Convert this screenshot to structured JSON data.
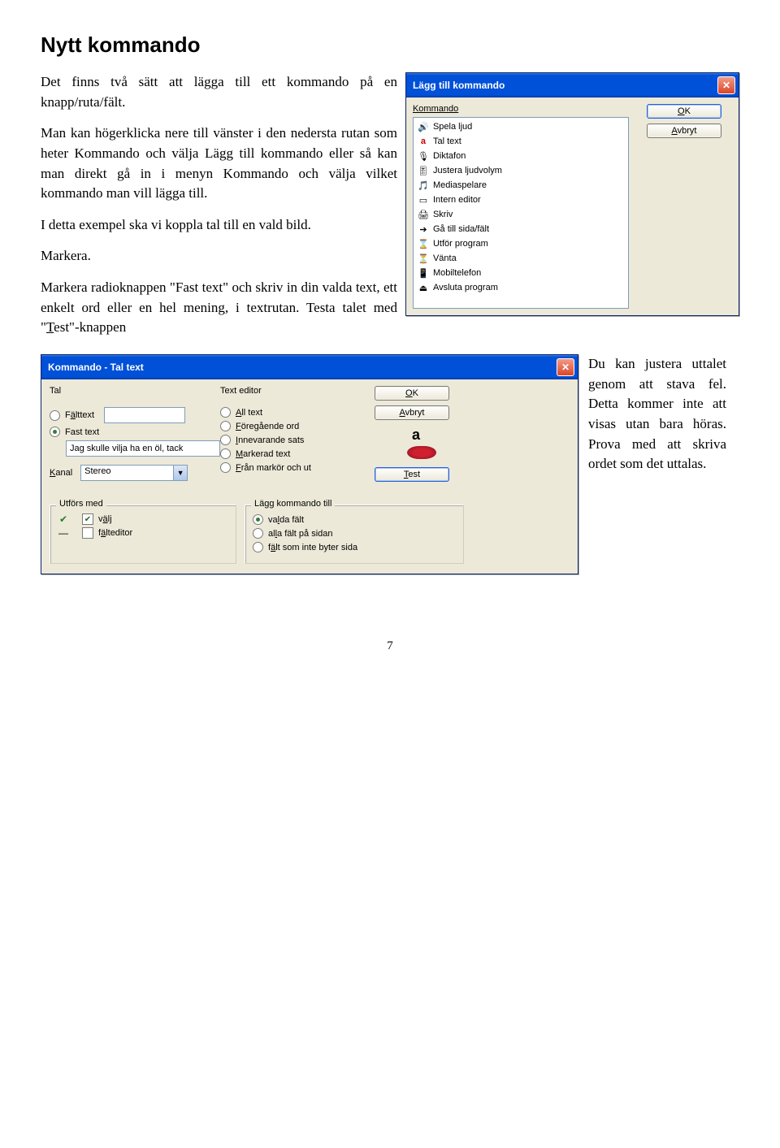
{
  "heading": "Nytt kommando",
  "para1": "Det finns två sätt att lägga till ett kommando på en knapp/ruta/fält.",
  "para2": "Man kan högerklicka nere till vänster i den nedersta rutan som heter Kommando och välja Lägg till kommando eller så kan man direkt gå in i menyn Kommando och välja vilket kommando man vill lägga till.",
  "para3": "I detta exempel ska vi koppla tal till en vald bild.",
  "para4": "Markera.",
  "para5a": "Markera radioknappen \"Fast text\" och skriv in din valda text, ett enkelt ord eller en hel mening, i textrutan. Testa talet med \"",
  "para5b": "T",
  "para5c": "est\"-knappen",
  "dlg1": {
    "title": "Lägg till kommando",
    "label": "Kommando",
    "ok_pre": "O",
    "ok_mid": "K",
    "cancel_pre": "A",
    "cancel_rest": "vbryt",
    "items": [
      {
        "label": "Spela ljud"
      },
      {
        "label": "Tal text"
      },
      {
        "label": "Diktafon"
      },
      {
        "label": "Justera ljudvolym"
      },
      {
        "label": "Mediaspelare"
      },
      {
        "label": "Intern editor"
      },
      {
        "label": "Skriv"
      },
      {
        "label": "Gå till sida/fält"
      },
      {
        "label": "Utför program"
      },
      {
        "label": "Vänta"
      },
      {
        "label": "Mobiltelefon"
      },
      {
        "label": "Avsluta program"
      }
    ]
  },
  "dlg2": {
    "title": "Kommando - Tal text",
    "ok_pre": "O",
    "ok_mid": "K",
    "cancel_pre": "A",
    "cancel_rest": "vbryt",
    "test_pre": "T",
    "test_rest": "est",
    "tal_label": "Tal",
    "te_label": "Text editor",
    "falt_pre": "F",
    "falt_mid": "ä",
    "falt_rest": "lttext",
    "fast_label": "Fast text",
    "fast_value": "Jag skulle vilja ha en öl, tack",
    "kanal_pre": "K",
    "kanal_rest": "anal",
    "kanal_value": "Stereo",
    "te_items": [
      {
        "pre": "A",
        "rest": "ll text"
      },
      {
        "pre": "F",
        "rest": "öregående ord"
      },
      {
        "pre": "I",
        "rest": "nnevarande sats"
      },
      {
        "pre": "M",
        "rest": "arkerad text"
      },
      {
        "pre": "F",
        "rest": "rån markör och ut"
      }
    ],
    "utfors_label": "Utförs med",
    "valj_pre": "v",
    "valj_mid": "ä",
    "valj_rest": "lj",
    "falted_pre": "f",
    "falted_mid": "ä",
    "falted_rest": "lteditor",
    "lkt_label": "Lägg kommando till",
    "lkt_items": [
      {
        "pre": "va",
        "mid": "l",
        "rest": "da fält",
        "on": true
      },
      {
        "pre": "al",
        "mid": "l",
        "rest": "a fält på sidan",
        "on": false
      },
      {
        "pre": "f",
        "mid": "ä",
        "rest": "lt som inte byter sida",
        "on": false
      }
    ]
  },
  "side_text": "Du kan justera uttalet genom att stava fel. Detta kommer inte att visas utan bara höras. Prova med att skriva ordet som det uttalas.",
  "page": "7"
}
